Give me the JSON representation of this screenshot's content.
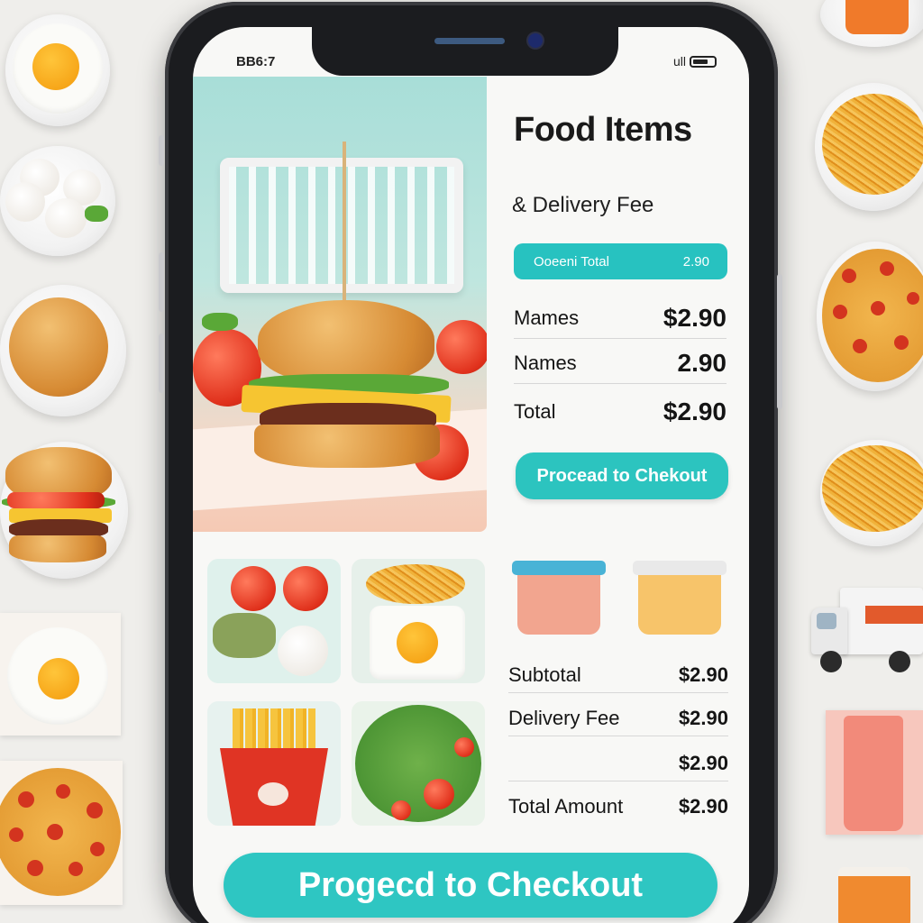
{
  "status_bar": {
    "time": "BB6:7",
    "signal": "ull"
  },
  "hero": {
    "caption": ""
  },
  "panel": {
    "title": "Food Items",
    "subtitle": "& Delivery Fee",
    "pill": {
      "label": "Ooeeni Total",
      "value": "2.90"
    },
    "rows": [
      {
        "label": "Mames",
        "value": "$2.90"
      },
      {
        "label": "Names",
        "value": "2.90"
      },
      {
        "label": "Total",
        "value": "$2.90"
      }
    ],
    "proceed_small": "Procead to Chekout"
  },
  "summary": {
    "rows": [
      {
        "label": "Subtotal",
        "value": "$2.90"
      },
      {
        "label": "Delivery Fee",
        "value": "$2.90"
      },
      {
        "label": "",
        "value": "$2.90"
      },
      {
        "label": "Total Amount",
        "value": "$2.90"
      }
    ]
  },
  "checkout_button": "Progecd to Checkout",
  "colors": {
    "accent": "#2cc4bf",
    "phone_body": "#1b1c1f",
    "background": "#efeeeb"
  }
}
